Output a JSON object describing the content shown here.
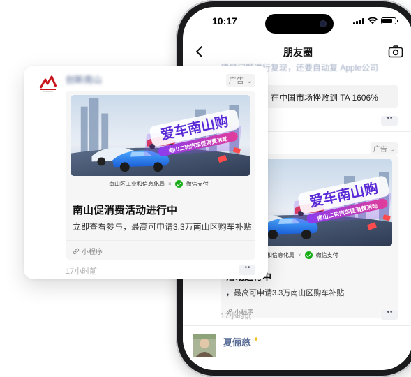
{
  "status": {
    "time": "10:17"
  },
  "nav": {
    "title": "朋友圈"
  },
  "feed_prev": {
    "text_line": "建局问题进行复现，还要自动复 Apple公司",
    "link_text": "在中国市场挫败到 TA 1606%"
  },
  "ad": {
    "brand_name": "创新南山",
    "tag_label": "广告",
    "banner_headline": "爱车南山购",
    "banner_sub": "南山二轮汽车促消费活动",
    "source_left": "南山区工业和信息化局",
    "source_sep": "×",
    "source_right": "微信支付",
    "title": "南山促消费活动进行中",
    "desc": "立即查看参与，最高可申请3.3万南山区购车补贴",
    "mini_program": "小程序",
    "time": "17小时前"
  },
  "phone_ad": {
    "title": "活动进行中",
    "desc": "，最高可申请3.3万南山区购车补贴",
    "mini_program": "小程序",
    "time": "17小时前",
    "tag_label": "广告"
  },
  "next_post": {
    "user_name": "夏俪慈"
  },
  "icons": {
    "back": "chevron-left-icon",
    "camera": "camera-icon",
    "chevron_down": "chevron-down-icon",
    "link": "link-icon",
    "more": "more-icon"
  },
  "colors": {
    "link_blue": "#576b95",
    "wechat_green": "#1aad19",
    "card_bg": "#f6f6f7",
    "brand_red": "#c8161d"
  }
}
